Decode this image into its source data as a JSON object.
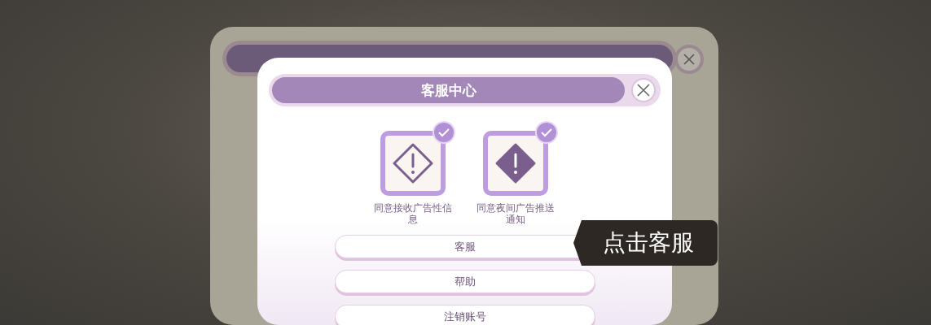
{
  "dialog": {
    "title": "客服中心"
  },
  "options": [
    {
      "label": "同意接收广告性信息",
      "kind": "outline",
      "checked": true
    },
    {
      "label": "同意夜间广告推送通知",
      "kind": "solid",
      "checked": true
    }
  ],
  "buttons": [
    "客服",
    "帮助",
    "注销账号"
  ],
  "tooltip": {
    "text": "点击客服"
  }
}
